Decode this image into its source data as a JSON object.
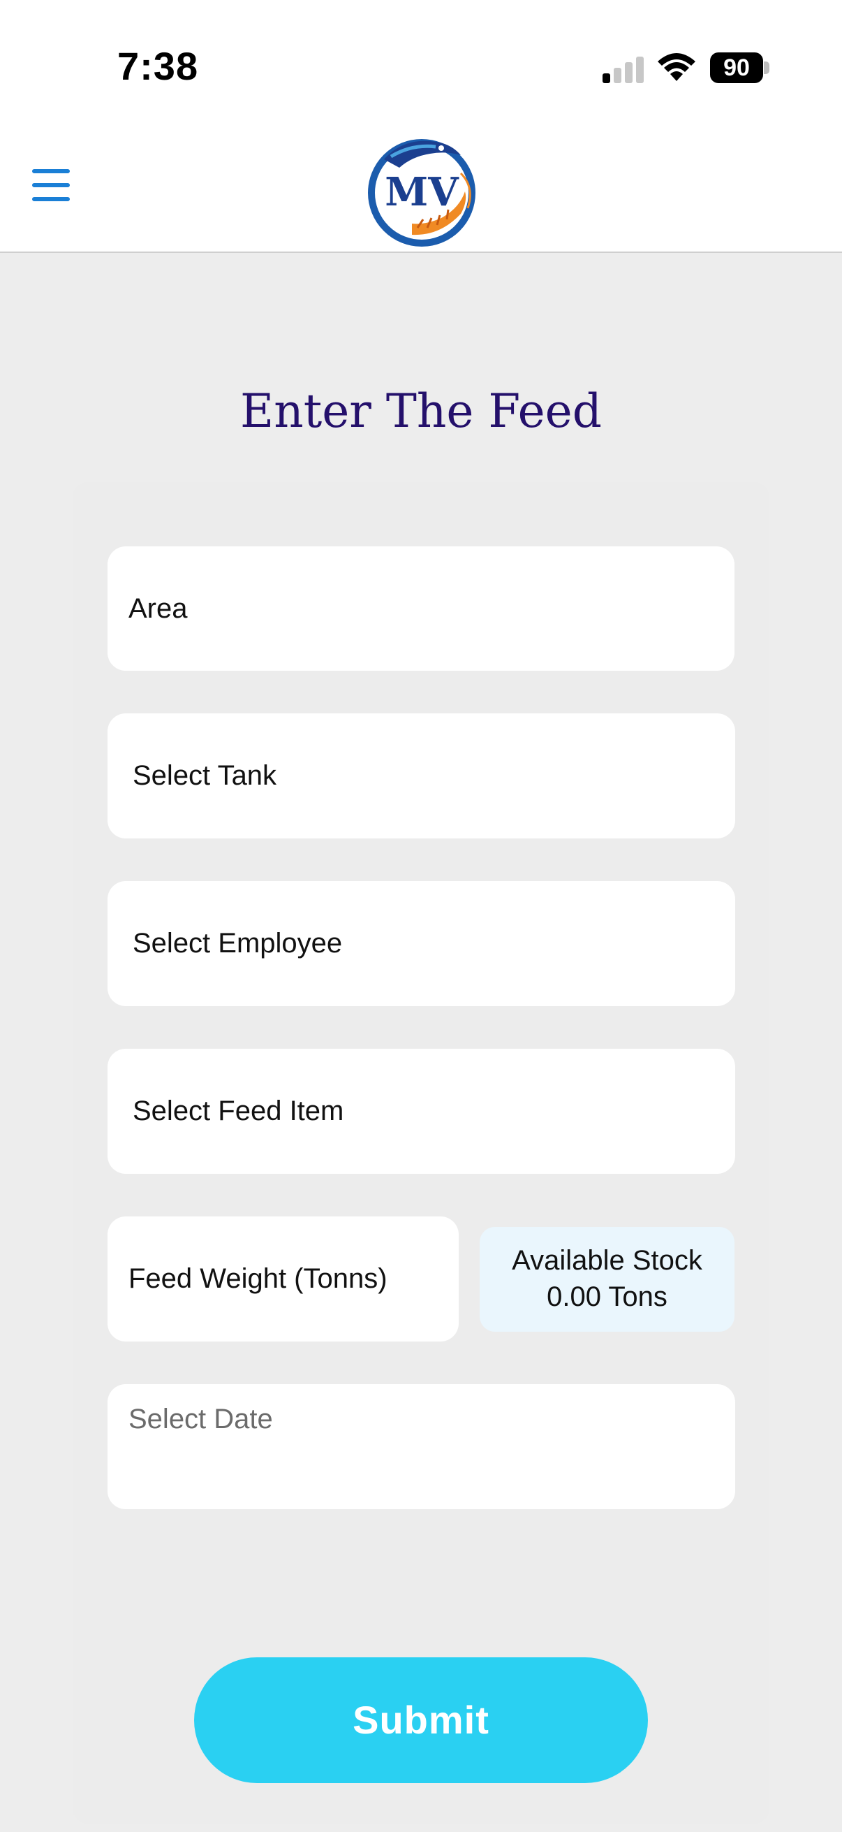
{
  "status_bar": {
    "time": "7:38",
    "battery": "90",
    "icons": [
      "cellular-signal-icon",
      "wifi-icon",
      "battery-icon"
    ]
  },
  "header": {
    "menu_icon": "hamburger-menu-icon",
    "logo_text": "MV",
    "colors": {
      "menu": "#1a7fd6",
      "logo_blue": "#1b3f8f",
      "logo_orange": "#f08a24"
    }
  },
  "page": {
    "title": "Enter The Feed",
    "title_color": "#24106b"
  },
  "form": {
    "area_label": "Area",
    "tank_placeholder": "Select Tank",
    "employee_placeholder": "Select Employee",
    "feed_item_placeholder": "Select Feed Item",
    "feed_weight_placeholder": "Feed Weight (Tonns)",
    "available_stock_label": "Available Stock",
    "available_stock_value": "0.00 Tons",
    "date_placeholder": "Select Date",
    "submit_label": "Submit",
    "submit_color": "#2ad0f2"
  }
}
